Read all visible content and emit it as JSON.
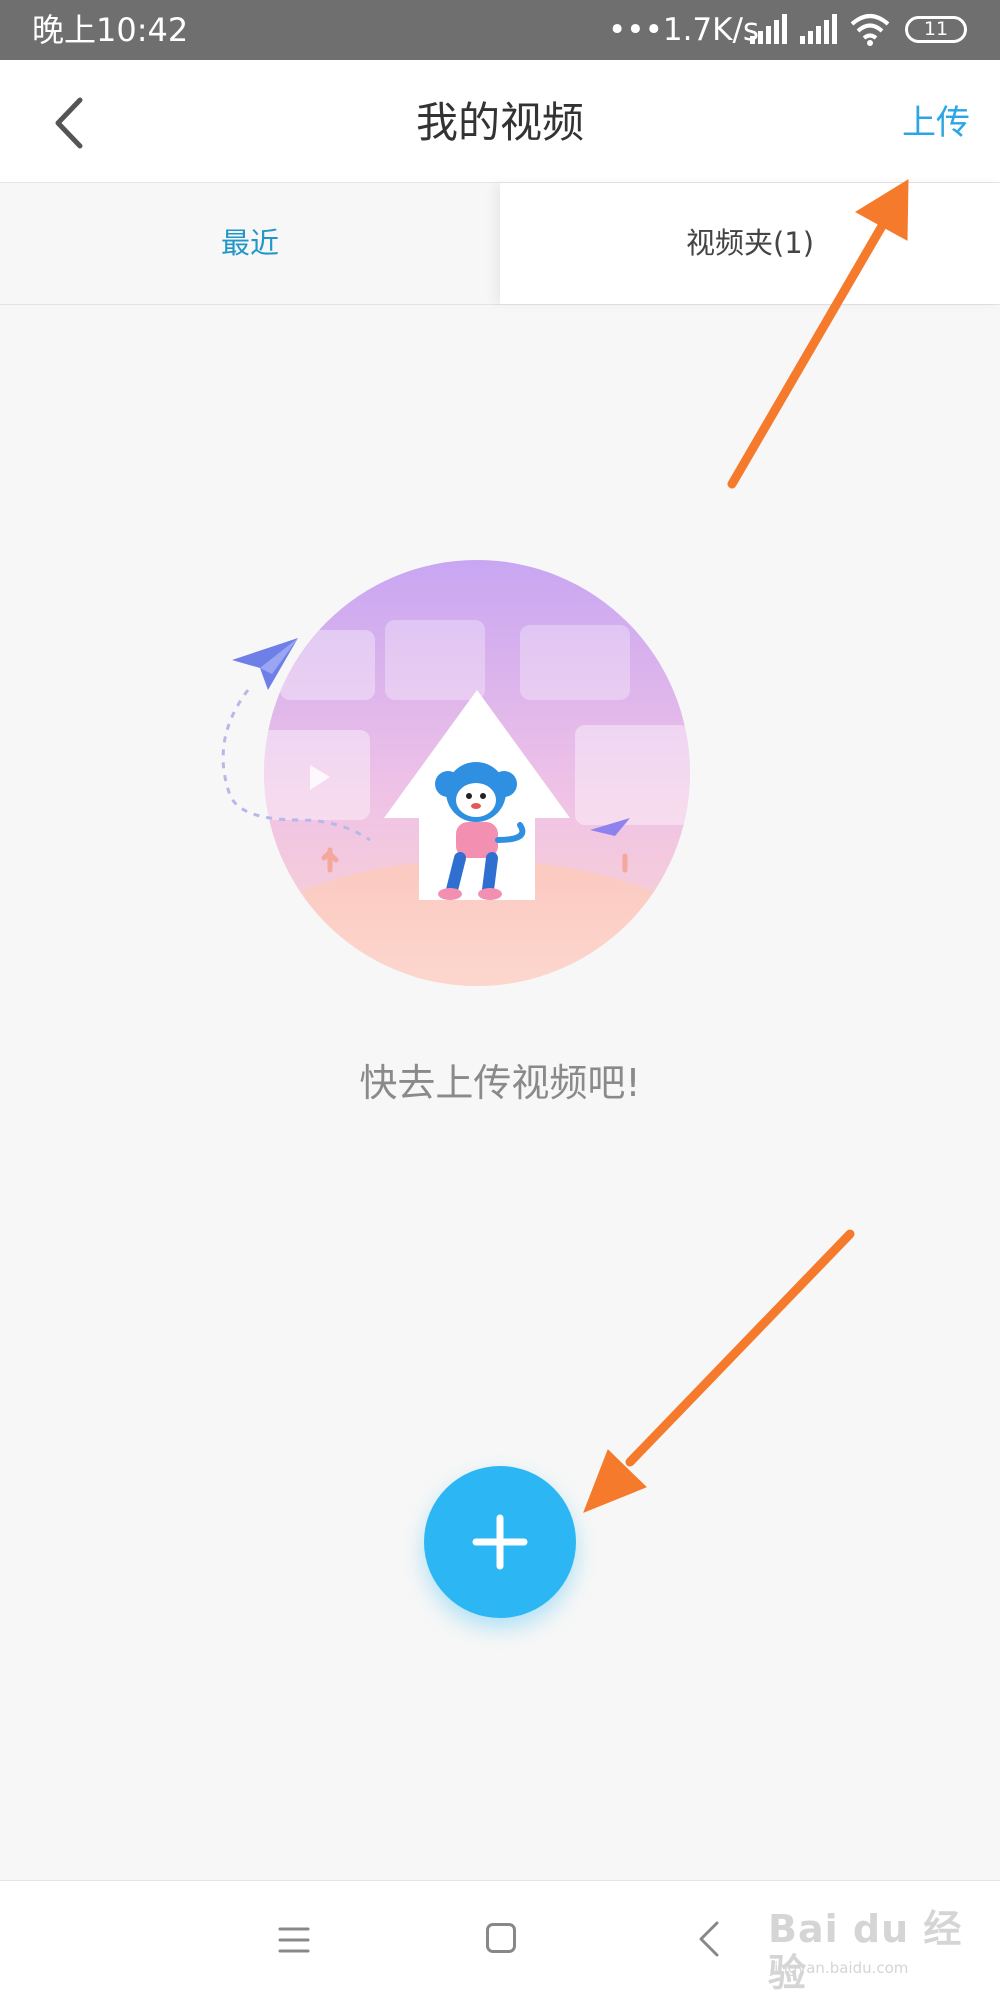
{
  "status_bar": {
    "time": "晚上10:42",
    "network_speed": "•••1.7K/s",
    "battery": "11"
  },
  "header": {
    "title": "我的视频",
    "upload_label": "上传"
  },
  "tabs": [
    {
      "label": "最近",
      "active": true
    },
    {
      "label": "视频夹(1)",
      "active": false
    }
  ],
  "empty_state": {
    "message": "快去上传视频吧!"
  },
  "colors": {
    "accent": "#2aa6e6",
    "fab": "#2cb6f3",
    "annotation_arrow": "#f57a2c"
  },
  "watermark": {
    "brand": "Bai du 经验",
    "url": "jingyan.baidu.com"
  }
}
